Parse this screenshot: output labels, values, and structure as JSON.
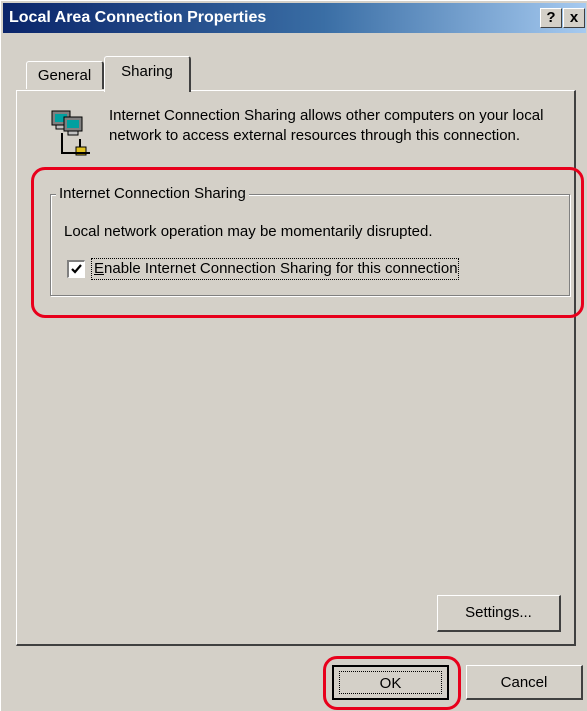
{
  "window": {
    "title": "Local Area Connection Properties",
    "help_button": "?",
    "close_button": "x"
  },
  "tabs": [
    {
      "label": "General",
      "selected": false
    },
    {
      "label": "Sharing",
      "selected": true
    }
  ],
  "sharing": {
    "description": "Internet Connection Sharing allows other computers on your local network to access external resources through this connection.",
    "icon": "network-connection-icon",
    "group": {
      "legend": "Internet Connection Sharing",
      "note": "Local network operation may be momentarily disrupted.",
      "checkbox": {
        "accel": "E",
        "label_rest": "nable Internet Connection Sharing for this connection",
        "checked": true
      }
    },
    "settings_button": {
      "prefix": "Settin",
      "accel": "g",
      "suffix": "s..."
    }
  },
  "buttons": {
    "ok": "OK",
    "cancel": "Cancel"
  },
  "colors": {
    "dialog_face": "#d4d0c8",
    "title_start": "#0a246a",
    "title_end": "#a6caf0",
    "highlight": "#e8001c"
  }
}
